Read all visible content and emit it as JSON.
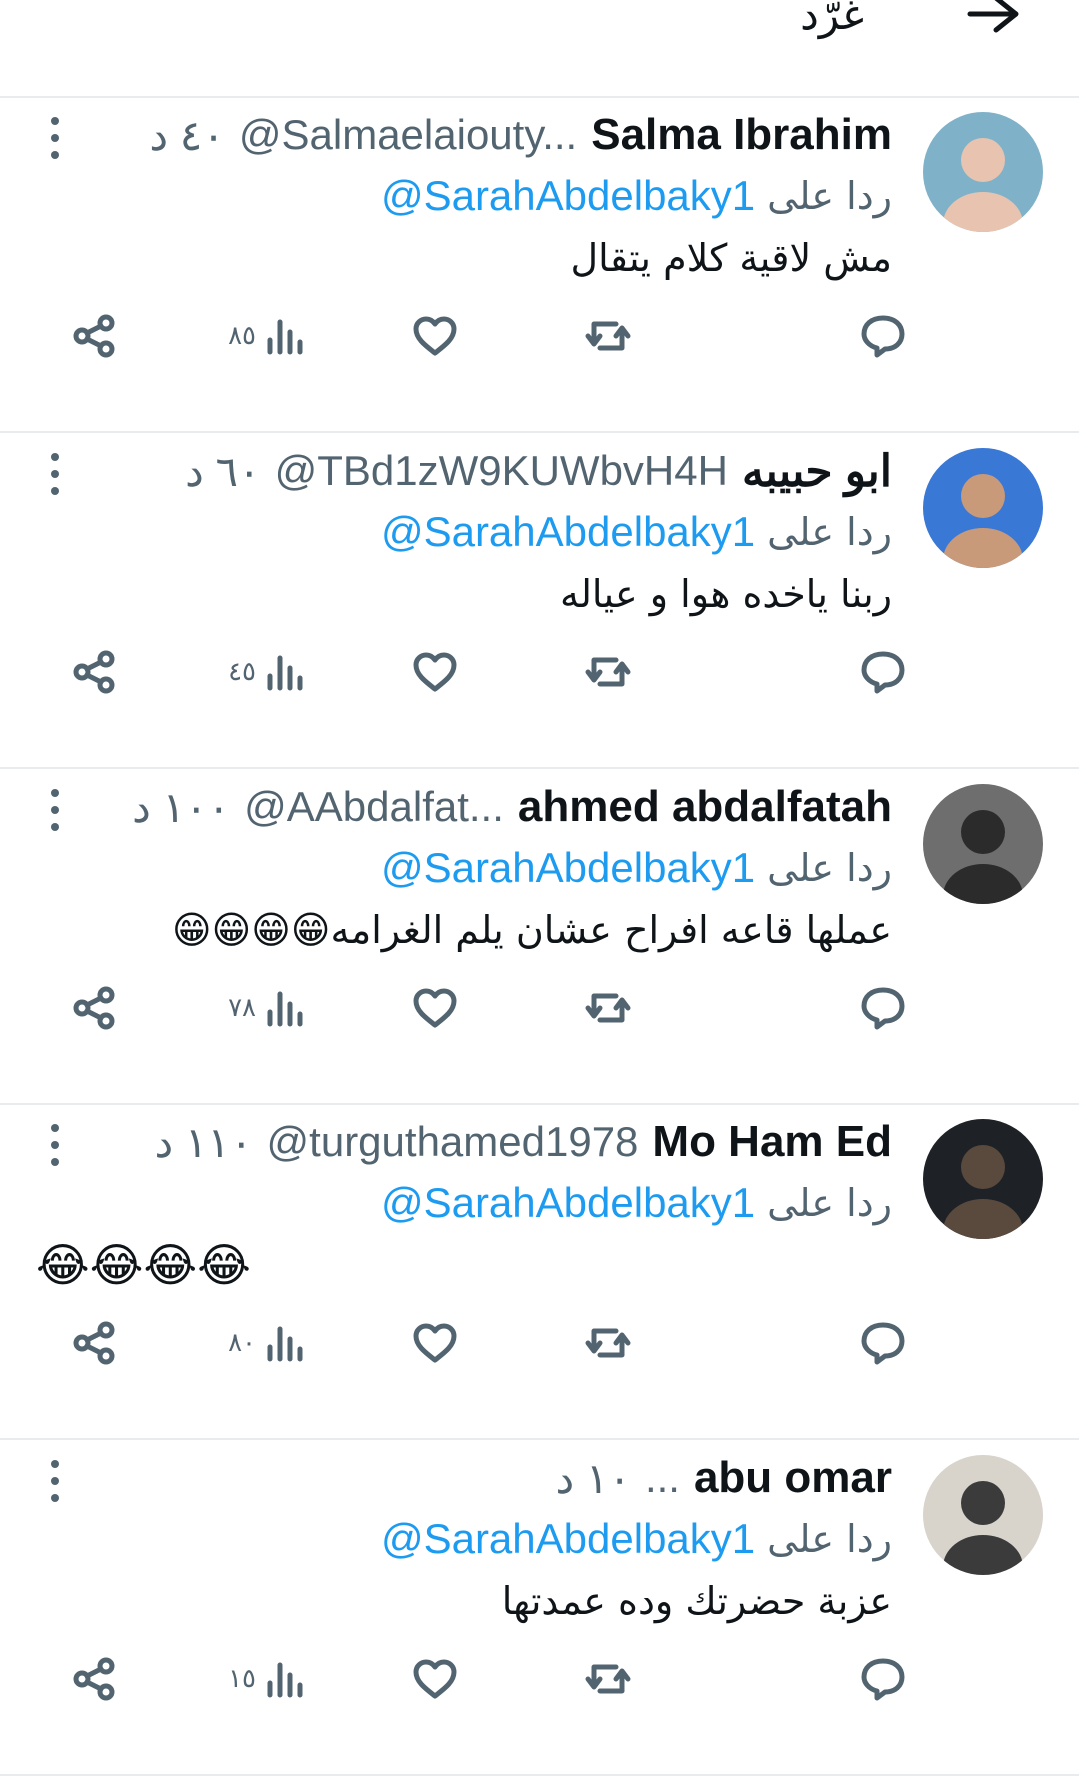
{
  "header": {
    "title": "غرّد"
  },
  "reply_prefix": "ردا على",
  "tweets": [
    {
      "name": "Salma Ibrahim",
      "handle": "@Salmaelaiouty...",
      "time": "٤٠ د",
      "reply_to": "@SarahAbdelbaky1",
      "text": "مش لاقية كلام يتقال",
      "views": "٨٥",
      "avatar_colors": [
        "#7fb2c9",
        "#e8c4b0"
      ]
    },
    {
      "name": "ابو حبيبه",
      "handle": "@TBd1zW9KUWbvH4H",
      "time": "٦٠ د",
      "reply_to": "@SarahAbdelbaky1",
      "text": "ربنا ياخده هوا و عياله",
      "views": "٤٥",
      "avatar_colors": [
        "#3a78d6",
        "#c89a7a"
      ]
    },
    {
      "name": "ahmed abdalfatah",
      "handle": "@AAbdalfat...",
      "time": "١٠٠ د",
      "reply_to": "@SarahAbdelbaky1",
      "text": "عملها قاعه افراح عشان يلم الغرامه😁😁😁😁",
      "views": "٧٨",
      "avatar_colors": [
        "#6e6e6e",
        "#2b2b2b"
      ]
    },
    {
      "name": "Mo Ham Ed",
      "handle": "@turguthamed1978",
      "time": "١١٠ د",
      "reply_to": "@SarahAbdelbaky1",
      "text": "😂😂😂😂",
      "views": "٨٠",
      "avatar_colors": [
        "#1e2226",
        "#5a4a3e"
      ]
    },
    {
      "name": "abu omar",
      "handle": "...",
      "time": "١٠ د",
      "reply_to": "@SarahAbdelbaky1",
      "text": "عزبة حضرتك وده عمدتها",
      "views": "١٥",
      "avatar_colors": [
        "#d8d4cc",
        "#3b3b3b"
      ]
    }
  ],
  "colors": {
    "text": "#0f1419",
    "secondary": "#536471",
    "link": "#1d9bf0",
    "divider": "#e8ecef"
  },
  "icons": [
    "back-arrow-icon",
    "more-vertical-icon",
    "reply-icon",
    "retweet-icon",
    "like-icon",
    "views-icon",
    "share-icon"
  ]
}
